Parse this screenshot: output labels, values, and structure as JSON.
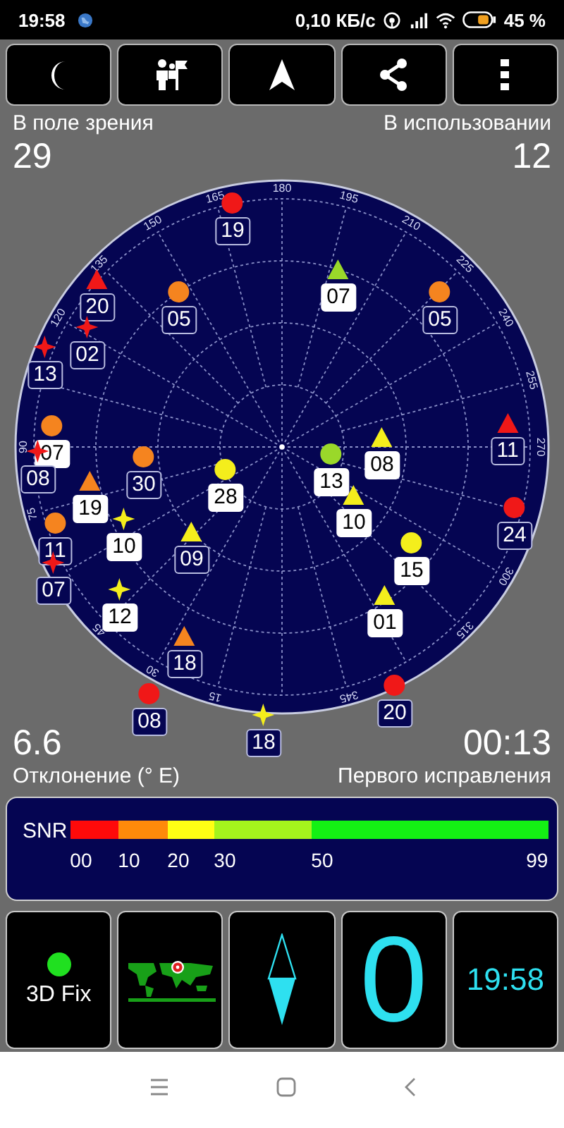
{
  "status_bar": {
    "time": "19:58",
    "speed": "0,10 КБ/с",
    "battery": "45 %"
  },
  "sky": {
    "in_view_label": "В поле зрения",
    "in_view": "29",
    "in_use_label": "В использовании",
    "in_use": "12",
    "azimuth_ticks": [
      "120",
      "135",
      "150",
      "165",
      "180",
      "195",
      "210",
      "225",
      "240",
      "255",
      "270",
      "300",
      "315",
      "345",
      "15",
      "30",
      "45",
      "75",
      "90"
    ],
    "satellites": [
      {
        "label": "19",
        "kind": "circle",
        "color": "#f01818",
        "used": false
      },
      {
        "label": "07",
        "kind": "triangle",
        "color": "#9ad82a",
        "used": true
      },
      {
        "label": "20",
        "kind": "triangle",
        "color": "#f01818",
        "used": false
      },
      {
        "label": "05",
        "kind": "circle",
        "color": "#f5841f",
        "used": false
      },
      {
        "label": "05",
        "kind": "circle",
        "color": "#f5841f",
        "used": false
      },
      {
        "label": "02",
        "kind": "star",
        "color": "#f01818",
        "used": false
      },
      {
        "label": "13",
        "kind": "star",
        "color": "#f01818",
        "used": false
      },
      {
        "label": "11",
        "kind": "triangle",
        "color": "#f01818",
        "used": false
      },
      {
        "label": "07",
        "kind": "circle",
        "color": "#f5841f",
        "used": true
      },
      {
        "label": "08",
        "kind": "star",
        "color": "#f01818",
        "used": false
      },
      {
        "label": "08",
        "kind": "triangle",
        "color": "#f4ee1c",
        "used": true
      },
      {
        "label": "30",
        "kind": "circle",
        "color": "#f5841f",
        "used": false
      },
      {
        "label": "13",
        "kind": "circle",
        "color": "#9ad82a",
        "used": true
      },
      {
        "label": "28",
        "kind": "circle",
        "color": "#f4ee1c",
        "used": true
      },
      {
        "label": "19",
        "kind": "triangle",
        "color": "#f5841f",
        "used": true
      },
      {
        "label": "10",
        "kind": "triangle",
        "color": "#f4ee1c",
        "used": true
      },
      {
        "label": "24",
        "kind": "circle",
        "color": "#f01818",
        "used": false
      },
      {
        "label": "11",
        "kind": "circle",
        "color": "#f5841f",
        "used": false
      },
      {
        "label": "07",
        "kind": "star",
        "color": "#f01818",
        "used": false
      },
      {
        "label": "10",
        "kind": "star",
        "color": "#f4ee1c",
        "used": true
      },
      {
        "label": "09",
        "kind": "triangle",
        "color": "#f4ee1c",
        "used": false
      },
      {
        "label": "15",
        "kind": "circle",
        "color": "#f4ee1c",
        "used": true
      },
      {
        "label": "12",
        "kind": "star",
        "color": "#f4ee1c",
        "used": true
      },
      {
        "label": "01",
        "kind": "triangle",
        "color": "#f4ee1c",
        "used": true
      },
      {
        "label": "18",
        "kind": "triangle",
        "color": "#f5841f",
        "used": false
      },
      {
        "label": "08",
        "kind": "circle",
        "color": "#f01818",
        "used": false
      },
      {
        "label": "20",
        "kind": "circle",
        "color": "#f01818",
        "used": false
      },
      {
        "label": "18",
        "kind": "star",
        "color": "#f4ee1c",
        "used": false
      }
    ],
    "declination": "6.6",
    "declination_label": "Отклонение (° E)",
    "first_fix": "00:13",
    "first_fix_label": "Первого исправления"
  },
  "snr": {
    "label": "SNR",
    "segments": [
      {
        "from": "00",
        "color": "#ff0a0a"
      },
      {
        "from": "10",
        "color": "#ff8a0a"
      },
      {
        "from": "20",
        "color": "#ffff14"
      },
      {
        "from": "30",
        "color": "#a4f41c"
      },
      {
        "from": "50",
        "color": "#14f014"
      }
    ],
    "end": "99"
  },
  "tiles": {
    "fix": "3D Fix",
    "speed": "0",
    "clock": "19:58"
  }
}
